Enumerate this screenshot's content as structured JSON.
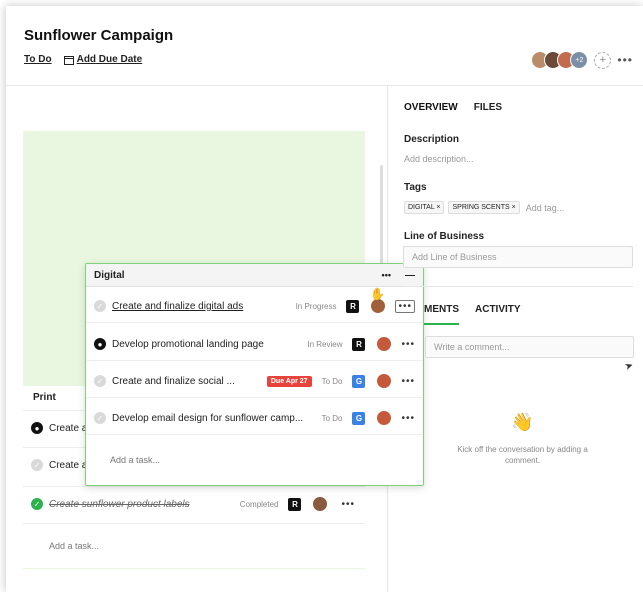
{
  "header": {
    "title": "Sunflower Campaign",
    "status_link": "To Do",
    "due_date_link": "Add Due Date",
    "extra_members": "+2",
    "add_member": "+",
    "more": "•••"
  },
  "board": {
    "print_column": {
      "title": "Print",
      "tasks": [
        {
          "label": "Create a",
          "check": "black"
        },
        {
          "label": "Create a",
          "check": "grey"
        },
        {
          "label": "Create sunflower product labels",
          "status": "Completed",
          "check": "green",
          "app": "R"
        }
      ],
      "add_task": "Add a task..."
    },
    "digital_column": {
      "title": "Digital",
      "more": "•••",
      "minimize": "—",
      "tasks": [
        {
          "label": "Create and finalize digital ads",
          "status": "In Progress",
          "app": "R",
          "app_color": "dark",
          "check": "grey"
        },
        {
          "label": "Develop promotional landing page",
          "status": "In Review",
          "app": "R",
          "app_color": "dark",
          "check": "black"
        },
        {
          "label": "Create and finalize social ...",
          "status": "To Do",
          "due": "Due Apr 27",
          "app": "G",
          "app_color": "blue",
          "check": "grey"
        },
        {
          "label": "Develop email design for sunflower camp...",
          "status": "To Do",
          "app": "G",
          "app_color": "blue",
          "check": "grey"
        }
      ],
      "add_task": "Add a task..."
    }
  },
  "panel": {
    "tabs": [
      "OVERVIEW",
      "FILES"
    ],
    "description_label": "Description",
    "description_placeholder": "Add description...",
    "tags_label": "Tags",
    "tags": [
      "DIGITAL ×",
      "SPRING SCENTS ×"
    ],
    "tag_placeholder": "Add tag...",
    "lob_label": "Line of Business",
    "lob_placeholder": "Add Line of Business",
    "tabs2": [
      "MENTS",
      "ACTIVITY"
    ],
    "comment_placeholder": "Write a comment...",
    "empty_text": "Kick off the conversation by adding a comment."
  },
  "colors": {
    "accent": "#2bb24c",
    "due": "#e8433a",
    "column_bg": "#e9f7e1"
  }
}
